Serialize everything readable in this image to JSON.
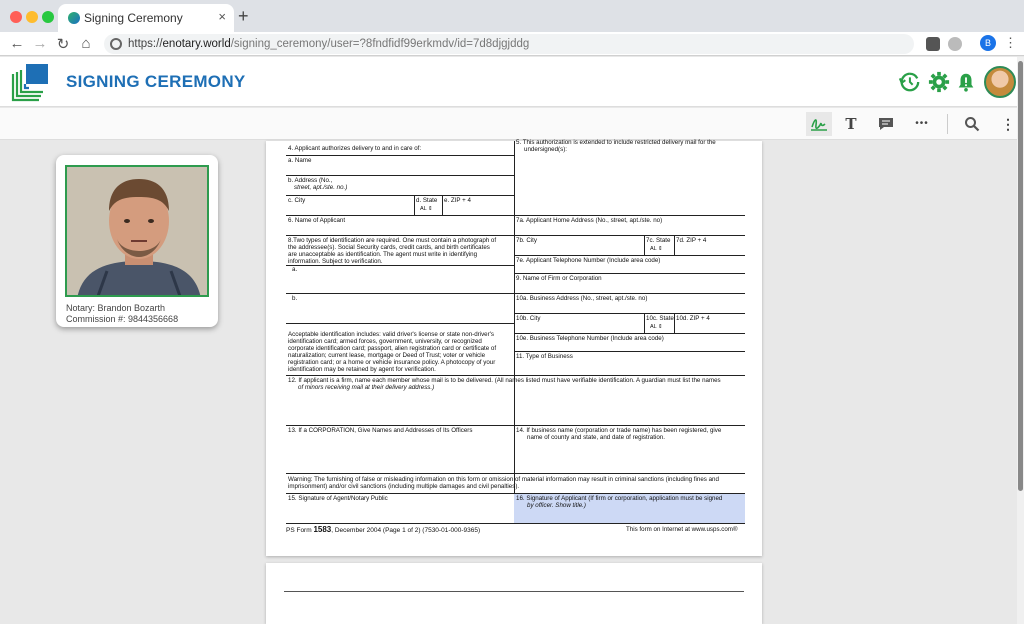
{
  "browser": {
    "tab_title": "Signing Ceremony",
    "tab_close": "×",
    "new_tab": "+",
    "url_scheme": "https://",
    "url_host": "enotary.world",
    "url_path": "/signing_ceremony/user=?8fndfidf99erkmdv/id=7d8djgjddg",
    "profile_initial": "B",
    "back_icon": "←",
    "forward_icon": "→",
    "reload_icon": "↻",
    "home_icon": "⌂",
    "menu_icon": "⋮"
  },
  "app": {
    "title": "SIGNING CEREMONY",
    "brand_color": "#1e6fb5",
    "accent_color": "#2aa048"
  },
  "toolbar": {
    "signature_tool": "ℊ̲",
    "text_tool": "T",
    "comment_tool": "💬",
    "more_tool": "•••",
    "search_tool": "🔍",
    "kebab": "⋮"
  },
  "notary": {
    "name": "Notary: Brandon Bozarth",
    "commission": "Commission #: 9844356668"
  },
  "form": {
    "f4": "4. Applicant authorizes delivery to and in care of:",
    "f4a": "a. Name",
    "f4b1": "b. Address (No.,",
    "f4b2": "street, apt./ste. no.)",
    "f4c": "c. City",
    "f4d": "d. State",
    "f4e": "e. ZIP + 4",
    "state_val": "AL",
    "f5a": "5. This authorization is extended to include restricted delivery mail for the",
    "f5b": "undersigned(s):",
    "f6": "6. Name of Applicant",
    "f7a": "7a. Applicant Home Address (No., street, apt./ste. no)",
    "f8a": "8.Two types of identification are required. One must contain a photograph of",
    "f8b": "the addressee(s). Social Security cards, credit cards, and birth certificates",
    "f8c": "are unacceptable as identification. The agent must write in identifying",
    "f8d": "information. Subject to verification.",
    "f8_a": "a.",
    "f8_b": "b.",
    "f7b": "7b. City",
    "f7c": "7c. State",
    "f7d": "7d. ZIP + 4",
    "f7e": "7e. Applicant Telephone Number (Include area code)",
    "f9": "9. Name of Firm or Corporation",
    "f10a": "10a. Business Address (No., street, apt./ste. no)",
    "f10b": "10b. City",
    "f10c": "10c. State",
    "f10d": "10d. ZIP + 4",
    "f10e": "10e. Business Telephone Number (Include area code)",
    "f11": "11. Type of Business",
    "acc1": "Acceptable identification includes: valid driver's license or state non-driver's",
    "acc2": "identification card; armed forces, government, university, or recognized",
    "acc3": "corporate identification card; passport, alien registration card or certificate of",
    "acc4": "naturalization; current lease, mortgage or Deed of Trust; voter or vehicle",
    "acc5": "registration card; or a home or vehicle insurance policy. A photocopy of your",
    "acc6": "identification may be retained by agent for verification.",
    "f12a": "12. If applicant is a firm, name each member whose mail is to be delivered. (All names listed must have verifiable identification. A guardian must list the names",
    "f12b": "of minors receiving mail at their delivery address.)",
    "f13": "13. If a CORPORATION, Give Names and Addresses of Its Officers",
    "f14a": "14. If business name (corporation or trade name) has been registered, give",
    "f14b": "name of county and state, and date of registration.",
    "warn1": "Warning: The furnishing of false or misleading information on this form or omission of material information may result in criminal sanctions (including fines and",
    "warn2": "imprisonment) and/or civil sanctions (including multiple damages and civil penalties).",
    "f15": "15. Signature of Agent/Notary Public",
    "f16a": "16. Signature of Applicant (If firm or corporation, application must be signed",
    "f16b": "by officer. Show title.)",
    "footer_left_pre": "PS Form ",
    "footer_left_num": "1583",
    "footer_left_post": ", December 2004 (Page 1 of 2) (7530-01-000-9365)",
    "footer_right": "This form on Internet at www.usps.com®"
  }
}
